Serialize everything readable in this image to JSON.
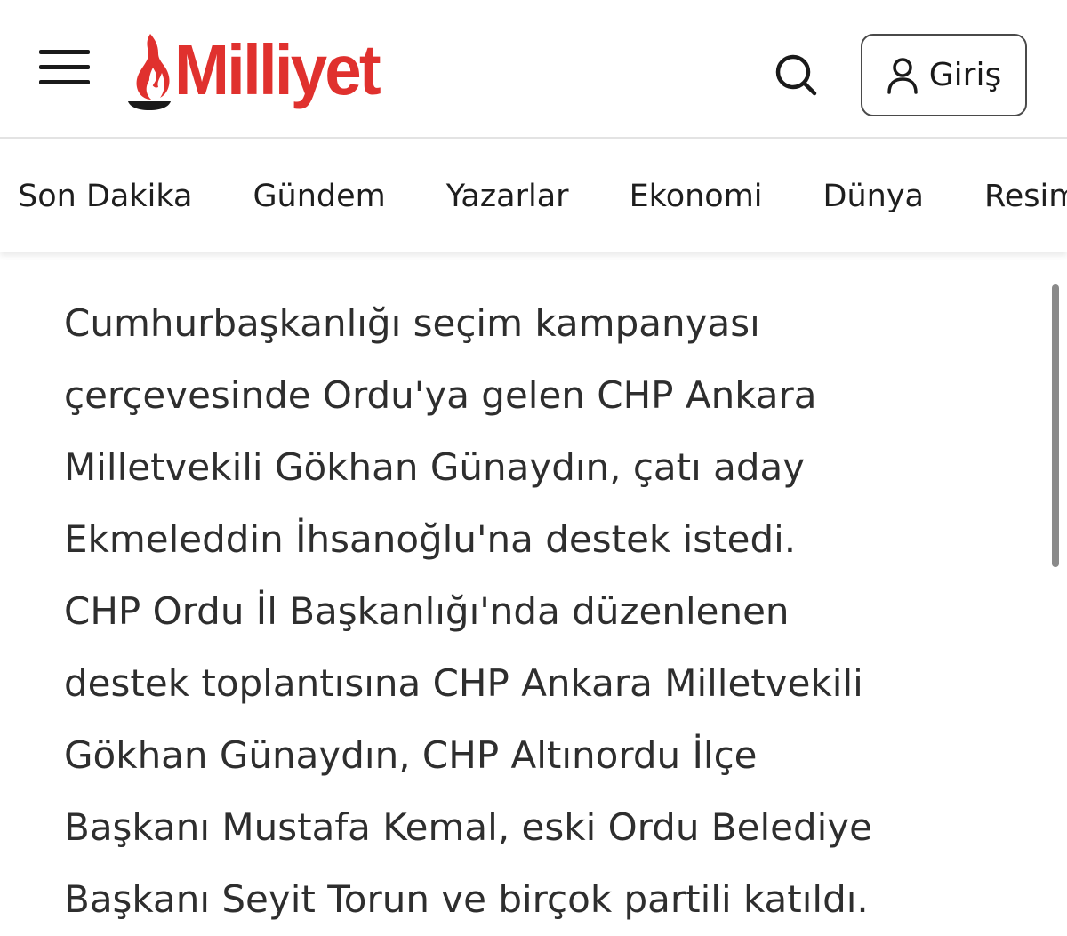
{
  "header": {
    "logo_text": "Milliyet",
    "brand_color": "#e0312e",
    "menu_icon": "hamburger-menu-icon",
    "search_icon": "search-icon",
    "login_label": "Giriş",
    "login_icon": "user-icon"
  },
  "nav": {
    "items": [
      {
        "label": "Son Dakika"
      },
      {
        "label": "Gündem"
      },
      {
        "label": "Yazarlar"
      },
      {
        "label": "Ekonomi"
      },
      {
        "label": "Dünya"
      },
      {
        "label": "Resim"
      }
    ]
  },
  "article": {
    "lines": [
      "Cumhurbaşkanlığı seçim kampanyası",
      "çerçevesinde Ordu'ya gelen CHP Ankara",
      "Milletvekili Gökhan Günaydın, çatı aday",
      "Ekmeleddin İhsanoğlu'na destek istedi.",
      "CHP Ordu İl Başkanlığı'nda düzenlenen",
      "destek toplantısına CHP Ankara Milletvekili",
      "Gökhan Günaydın, CHP Altınordu İlçe",
      "Başkanı Mustafa Kemal, eski Ordu Belediye",
      "Başkanı Seyit Torun ve birçok partili katıldı."
    ]
  }
}
